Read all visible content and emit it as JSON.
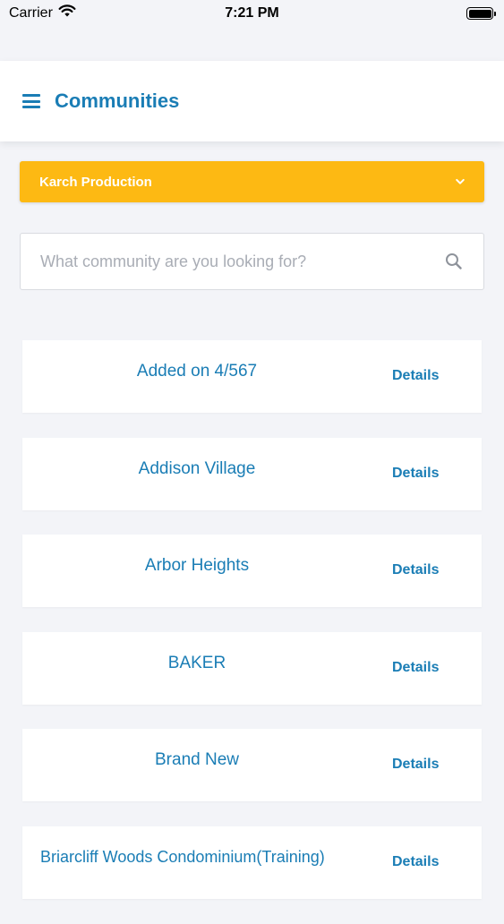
{
  "status_bar": {
    "carrier": "Carrier",
    "time": "7:21 PM",
    "icons": [
      "wifi-icon",
      "battery-icon"
    ]
  },
  "header": {
    "title": "Communities",
    "menu_icon": "hamburger-menu-icon"
  },
  "org_select": {
    "selected": "Karch Production",
    "icon": "chevron-down-icon"
  },
  "search": {
    "placeholder": "What community are you looking for?",
    "value": "",
    "icon": "search-icon"
  },
  "communities": [
    {
      "name": "Added on 4/567",
      "action": "Details"
    },
    {
      "name": "Addison Village",
      "action": "Details"
    },
    {
      "name": "Arbor Heights",
      "action": "Details"
    },
    {
      "name": "BAKER",
      "action": "Details"
    },
    {
      "name": "Brand New",
      "action": "Details"
    },
    {
      "name": "Briarcliff Woods Condominium(Training)",
      "action": "Details"
    }
  ],
  "colors": {
    "accent": "#1a7db5",
    "select_bg": "#fdb913",
    "page_bg": "#f3f4f8"
  }
}
